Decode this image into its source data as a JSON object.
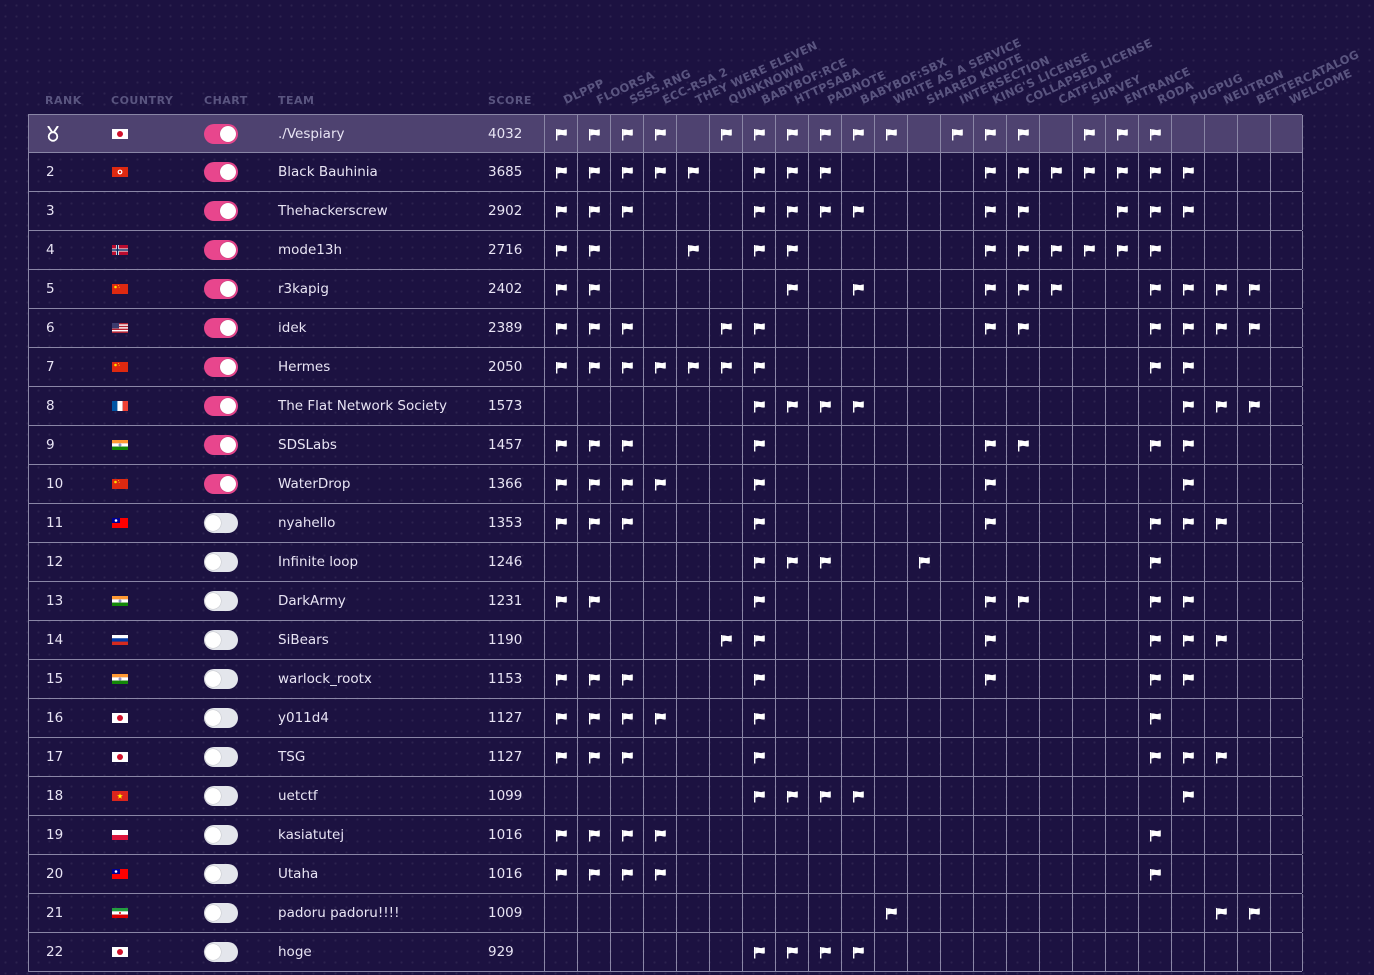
{
  "headers": {
    "rank": "RANK",
    "country": "COUNTRY",
    "chart": "CHART",
    "team": "TEAM",
    "score": "SCORE"
  },
  "challenges": [
    "DLPPP",
    "FLOORSA",
    "SSSS.RNG",
    "ECC-RSA 2",
    "THEY WERE ELEVEN",
    "QUNKNOWN",
    "BABYBOF:RCE",
    "HTTPSABA",
    "PADNOTE",
    "BABYBOF:SBX",
    "WRITE AS A SERVICE",
    "SHARED KNOTE",
    "INTERSECTION",
    "KING'S LICENSE",
    "COLLAPSED LICENSE",
    "CATFLAP",
    "SURVEY",
    "ENTRANCE",
    "RODA",
    "PUGPUG",
    "NEUTRON",
    "BETTERCATALOG",
    "WELCOME"
  ],
  "colors": {
    "background": "#1c1241",
    "highlight_row": "#4e4270",
    "toggle_on": "#e8468d",
    "toggle_off": "#e4e6ec",
    "grid": "#8a86a6",
    "header_text": "#5a5580"
  },
  "first_place_icon": "medal-icon",
  "rows": [
    {
      "rank": "1",
      "country": "jp",
      "chart": true,
      "team": "./Vespiary",
      "score": "4032",
      "solves": "1111011111101110111000001"
    },
    {
      "rank": "2",
      "country": "hk",
      "chart": true,
      "team": "Black Bauhinia",
      "score": "3685",
      "solves": "1111101110000111111100001"
    },
    {
      "rank": "3",
      "country": "",
      "chart": true,
      "team": "Thehackerscrew",
      "score": "2902",
      "solves": "1110001111000110011100001"
    },
    {
      "rank": "4",
      "country": "no",
      "chart": true,
      "team": "mode13h",
      "score": "2716",
      "solves": "1100101100000111111000001"
    },
    {
      "rank": "5",
      "country": "cn",
      "chart": true,
      "team": "r3kapig",
      "score": "2402",
      "solves": "1100000101000111001111001"
    },
    {
      "rank": "6",
      "country": "us",
      "chart": true,
      "team": "idek",
      "score": "2389",
      "solves": "1110011000000110001111001"
    },
    {
      "rank": "7",
      "country": "cn",
      "chart": true,
      "team": "Hermes",
      "score": "2050",
      "solves": "1111111000000000001100001"
    },
    {
      "rank": "8",
      "country": "fr",
      "chart": true,
      "team": "The Flat Network Society",
      "score": "1573",
      "solves": "0000001111000000000111000"
    },
    {
      "rank": "9",
      "country": "in",
      "chart": true,
      "team": "SDSLabs",
      "score": "1457",
      "solves": "1110001000000110001100001"
    },
    {
      "rank": "10",
      "country": "cn",
      "chart": true,
      "team": "WaterDrop",
      "score": "1366",
      "solves": "1111001000000100000100001"
    },
    {
      "rank": "11",
      "country": "tw",
      "chart": false,
      "team": "nyahello",
      "score": "1353",
      "solves": "1110001000000100001110001"
    },
    {
      "rank": "12",
      "country": "",
      "chart": false,
      "team": "Infinite loop",
      "score": "1246",
      "solves": "0000001110010000001000001"
    },
    {
      "rank": "13",
      "country": "in",
      "chart": false,
      "team": "DarkArmy",
      "score": "1231",
      "solves": "1100001000000110001100001"
    },
    {
      "rank": "14",
      "country": "ru",
      "chart": false,
      "team": "SiBears",
      "score": "1190",
      "solves": "0000011000000100001110001"
    },
    {
      "rank": "15",
      "country": "in",
      "chart": false,
      "team": "warlock_rootx",
      "score": "1153",
      "solves": "1110001000000100001100001"
    },
    {
      "rank": "16",
      "country": "jp",
      "chart": false,
      "team": "y011d4",
      "score": "1127",
      "solves": "1111001000000000001000001"
    },
    {
      "rank": "17",
      "country": "jp",
      "chart": false,
      "team": "TSG",
      "score": "1127",
      "solves": "1110001000000000001110001"
    },
    {
      "rank": "18",
      "country": "vn",
      "chart": false,
      "team": "uetctf",
      "score": "1099",
      "solves": "0000001111000000000100001"
    },
    {
      "rank": "19",
      "country": "pl",
      "chart": false,
      "team": "kasiatutej",
      "score": "1016",
      "solves": "1111000000000000001000001"
    },
    {
      "rank": "20",
      "country": "tw",
      "chart": false,
      "team": "Utaha",
      "score": "1016",
      "solves": "1111000000000000001000001"
    },
    {
      "rank": "21",
      "country": "ir",
      "chart": false,
      "team": "padoru padoru!!!!",
      "score": "1009",
      "solves": "0000000000100000000011000"
    },
    {
      "rank": "22",
      "country": "jp",
      "chart": false,
      "team": "hoge",
      "score": "929",
      "solves": "0000001111000000000000000"
    }
  ]
}
